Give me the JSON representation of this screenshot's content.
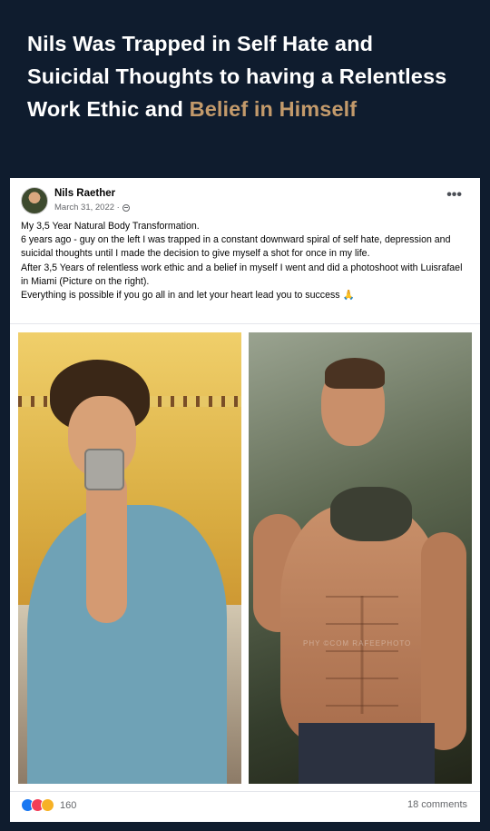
{
  "headline": {
    "text_main": "Nils Was Trapped in Self Hate and Suicidal Thoughts to having a Relentless Work Ethic and ",
    "text_accent": "Belief in Himself",
    "accent_color": "#c39a6b",
    "background": "#0f1c2e"
  },
  "post": {
    "author": "Nils Raether",
    "date": "March 31, 2022 ·",
    "privacy_icon": "globe-icon",
    "more_icon": "more-options-icon",
    "more_label": "•••",
    "paragraphs": [
      "My 3,5 Year Natural Body Transformation.",
      "6 years ago - guy on the left I was trapped in a constant downward spiral of self hate, depression and suicidal thoughts until I made the decision to give myself a shot for once in my life.",
      "After 3,5 Years of relentless work ethic and a belief in myself I went and did a photoshoot with Luisrafael in Miami (Picture on the right).",
      "Everything is possible if you go all in and let your heart lead you to success 🙏"
    ],
    "photos": {
      "before_icon": "before-photo",
      "after_icon": "after-photo",
      "watermark": "PHY  ©COM  RAFEEPHOTO"
    },
    "reactions": {
      "icons": [
        "like-icon",
        "love-icon",
        "wow-icon"
      ],
      "count": "160"
    },
    "comments": "18 comments"
  }
}
